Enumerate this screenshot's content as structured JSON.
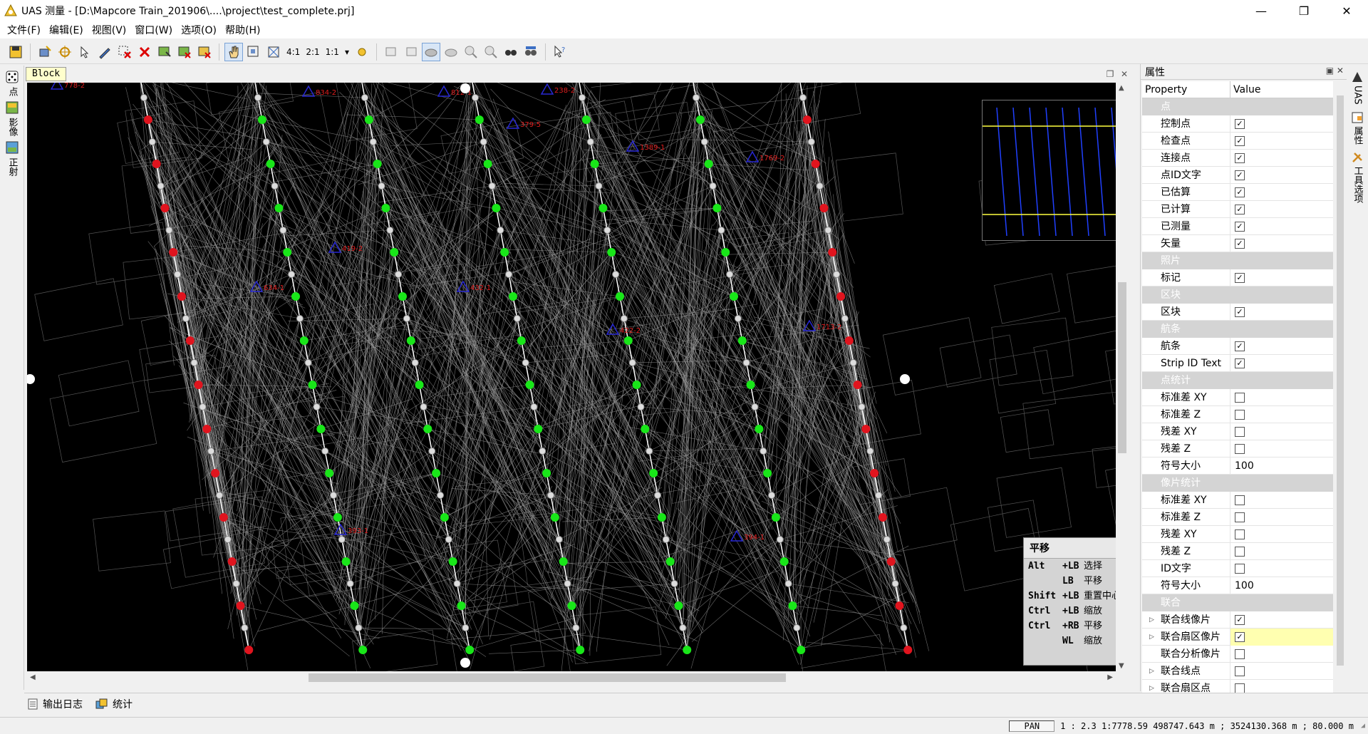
{
  "window": {
    "title": "UAS 测量 - [D:\\Mapcore Train_201906\\....\\project\\test_complete.prj]",
    "minimize": "—",
    "maximize": "❐",
    "close": "✕"
  },
  "menu": [
    "文件(F)",
    "编辑(E)",
    "视图(V)",
    "窗口(W)",
    "选项(O)",
    "帮助(H)"
  ],
  "toolbar": {
    "zoom_ratios": [
      "4:1",
      "2:1",
      "1:1"
    ]
  },
  "left_rail": [
    "点",
    "影像",
    "正射"
  ],
  "document": {
    "tab_label": "Block"
  },
  "viewer": {
    "point_labels": [
      "778-2",
      "834-2",
      "812-1",
      "238-2",
      "379-5",
      "1389-1",
      "1769-2",
      "419-2",
      "634-1",
      "432-1",
      "422-2",
      "1713-2",
      "393-1",
      "394-1"
    ],
    "help": {
      "title": "平移",
      "rows": [
        {
          "key": "Alt",
          "mod": "+LB",
          "action": "选择"
        },
        {
          "key": "",
          "mod": "LB",
          "action": "平移"
        },
        {
          "key": "Shift",
          "mod": "+LB",
          "action": "重置中心"
        },
        {
          "key": "Ctrl",
          "mod": "+LB",
          "action": "缩放"
        },
        {
          "key": "Ctrl",
          "mod": "+RB",
          "action": "平移"
        },
        {
          "key": "",
          "mod": "WL",
          "action": "缩放"
        }
      ]
    }
  },
  "properties": {
    "panel_title": "属性",
    "col_property": "Property",
    "col_value": "Value",
    "rows": [
      {
        "type": "cat",
        "label": "点"
      },
      {
        "type": "check",
        "label": "控制点",
        "checked": true
      },
      {
        "type": "check",
        "label": "检查点",
        "checked": true
      },
      {
        "type": "check",
        "label": "连接点",
        "checked": true
      },
      {
        "type": "check",
        "label": "点ID文字",
        "checked": true
      },
      {
        "type": "check",
        "label": "已估算",
        "checked": true
      },
      {
        "type": "check",
        "label": "已计算",
        "checked": true
      },
      {
        "type": "check",
        "label": "已测量",
        "checked": true
      },
      {
        "type": "check",
        "label": "矢量",
        "checked": true
      },
      {
        "type": "cat",
        "label": "照片"
      },
      {
        "type": "check",
        "label": "标记",
        "checked": true
      },
      {
        "type": "cat",
        "label": "区块"
      },
      {
        "type": "check",
        "label": "区块",
        "checked": true
      },
      {
        "type": "cat",
        "label": "航条"
      },
      {
        "type": "check",
        "label": "航条",
        "checked": true
      },
      {
        "type": "check",
        "label": "Strip ID Text",
        "checked": true
      },
      {
        "type": "cat",
        "label": "点统计"
      },
      {
        "type": "check",
        "label": "标准差 XY",
        "checked": false
      },
      {
        "type": "check",
        "label": "标准差 Z",
        "checked": false
      },
      {
        "type": "check",
        "label": "残差 XY",
        "checked": false
      },
      {
        "type": "check",
        "label": "残差 Z",
        "checked": false
      },
      {
        "type": "text",
        "label": "符号大小",
        "value": "100"
      },
      {
        "type": "cat",
        "label": "像片统计"
      },
      {
        "type": "check",
        "label": "标准差 XY",
        "checked": false
      },
      {
        "type": "check",
        "label": "标准差 Z",
        "checked": false
      },
      {
        "type": "check",
        "label": "残差 XY",
        "checked": false
      },
      {
        "type": "check",
        "label": "残差 Z",
        "checked": false
      },
      {
        "type": "check",
        "label": "ID文字",
        "checked": false
      },
      {
        "type": "text",
        "label": "符号大小",
        "value": "100"
      },
      {
        "type": "cat",
        "label": "联合"
      },
      {
        "type": "check",
        "label": "联合线像片",
        "checked": true,
        "expander": true
      },
      {
        "type": "check",
        "label": "联合扇区像片",
        "checked": true,
        "expander": true,
        "highlight": true
      },
      {
        "type": "check",
        "label": "联合分析像片",
        "checked": false
      },
      {
        "type": "check",
        "label": "联合线点",
        "checked": false,
        "expander": true
      },
      {
        "type": "check",
        "label": "联合扇区点",
        "checked": false,
        "expander": true
      }
    ]
  },
  "right_rail": [
    "UAS",
    "属性",
    "工具选项"
  ],
  "bottom_tabs": [
    "输出日志",
    "统计"
  ],
  "status": {
    "mode": "PAN",
    "coords": "1 : 2.3 1:7778.59 498747.643 m ; 3524130.368 m ; 80.000 m"
  },
  "colors": {
    "control_point": "#e0141e",
    "tie_point": "#19e619",
    "label_blue": "#2828d2",
    "label_red": "#e01e1e"
  }
}
